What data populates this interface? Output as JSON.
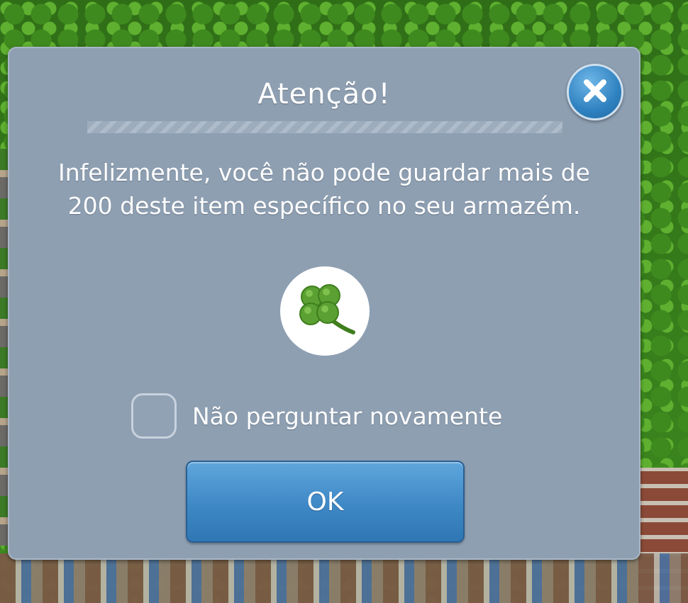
{
  "dialog": {
    "title": "Atenção!",
    "message_line1": "Infelizmente, você não pode guardar mais de",
    "message_line2": "200 deste item específico no seu armazém.",
    "item_icon": "four-leaf-clover",
    "checkbox": {
      "label": "Não perguntar novamente",
      "checked": false
    },
    "ok_label": "OK",
    "close_icon": "close-x"
  },
  "colors": {
    "dialog_bg": "#8e9fb2",
    "button_blue": "#3e88c6",
    "clover_green": "#5aa032"
  }
}
